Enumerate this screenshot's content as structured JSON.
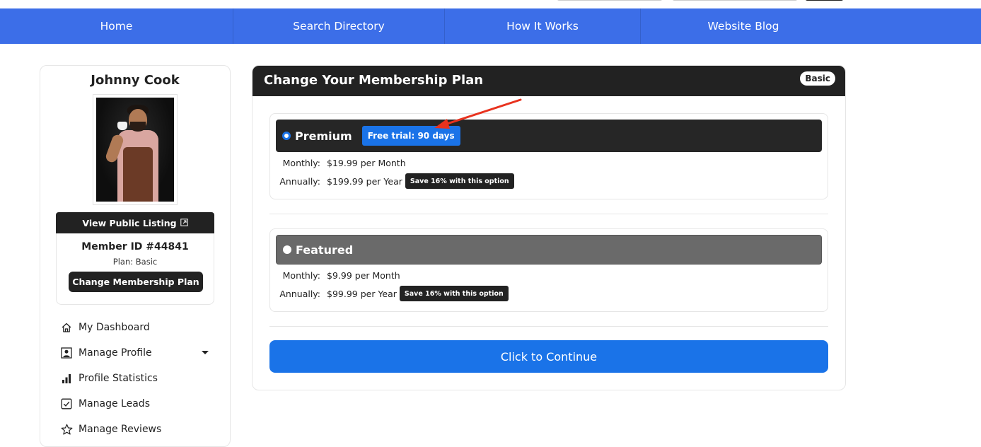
{
  "nav": {
    "items": [
      {
        "label": "Home"
      },
      {
        "label": "Search Directory"
      },
      {
        "label": "How It Works"
      },
      {
        "label": "Website Blog"
      }
    ]
  },
  "sidebar": {
    "member_name": "Johnny Cook",
    "view_listing_label": "View Public Listing",
    "member_id": "Member ID #44841",
    "plan_line": "Plan: Basic",
    "change_plan_label": "Change Membership Plan",
    "menu": [
      {
        "label": "My Dashboard",
        "icon": "home-icon"
      },
      {
        "label": "Manage Profile",
        "icon": "user-icon"
      },
      {
        "label": "Profile Statistics",
        "icon": "bar-chart-icon"
      },
      {
        "label": "Manage Leads",
        "icon": "checkbox-icon"
      },
      {
        "label": "Manage Reviews",
        "icon": "star-icon"
      }
    ]
  },
  "panel": {
    "title": "Change Your Membership Plan",
    "current_badge": "Basic",
    "plans": [
      {
        "name": "Premium",
        "selected": true,
        "trial_badge": "Free trial: 90 days",
        "monthly_label": "Monthly:",
        "monthly_price": "$19.99 per Month",
        "annual_label": "Annually:",
        "annual_price": "$199.99 per Year",
        "save_badge": "Save 16% with this option"
      },
      {
        "name": "Featured",
        "selected": false,
        "monthly_label": "Monthly:",
        "monthly_price": "$9.99 per Month",
        "annual_label": "Annually:",
        "annual_price": "$99.99 per Year",
        "save_badge": "Save 16% with this option"
      }
    ],
    "continue_label": "Click to Continue"
  },
  "colors": {
    "nav_bg": "#3c6ee8",
    "primary": "#1a73e8",
    "dark": "#222222",
    "annotation_arrow": "#e8321e"
  }
}
